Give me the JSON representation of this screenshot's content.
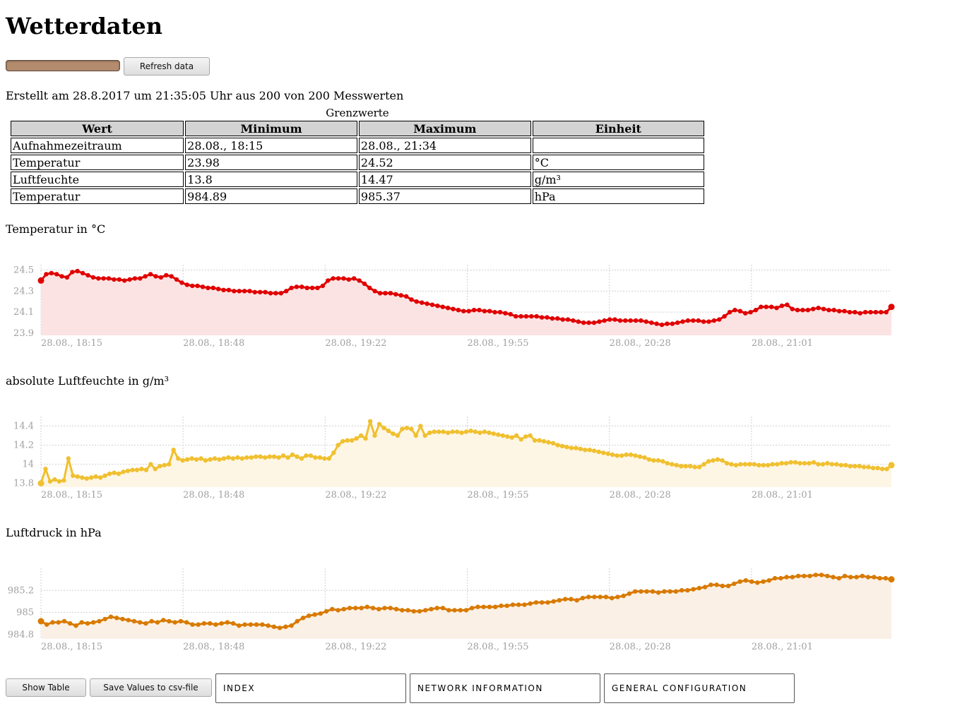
{
  "page": {
    "title": "Wetterdaten"
  },
  "toolbar": {
    "refresh_label": "Refresh data"
  },
  "loader": {
    "progress": 1.0
  },
  "info": "Erstellt am 28.8.2017 um 21:35:05 Uhr aus 200 von 200 Messwerten",
  "limits": {
    "caption": "Grenzwerte",
    "headers": [
      "Wert",
      "Minimum",
      "Maximum",
      "Einheit"
    ],
    "rows": [
      [
        "Aufnahmezeitraum",
        "28.08., 18:15",
        "28.08., 21:34",
        ""
      ],
      [
        "Temperatur",
        "23.98",
        "24.52",
        "°C"
      ],
      [
        "Luftfeuchte",
        "13.8",
        "14.47",
        "g/m³"
      ],
      [
        "Temperatur",
        "984.89",
        "985.37",
        "hPa"
      ]
    ]
  },
  "bottom": {
    "show_table": "Show Table",
    "save_csv": "Save Values to csv-file",
    "nav": [
      "INDEX",
      "NETWORK INFORMATION",
      "GENERAL CONFIGURATION"
    ]
  },
  "chart_data": [
    {
      "type": "area",
      "title": "Temperatur in °C",
      "x_ticks": [
        "28.08., 18:15",
        "28.08., 18:48",
        "28.08., 19:22",
        "28.08., 19:55",
        "28.08., 20:28",
        "28.08., 21:01"
      ],
      "x_range": [
        "28.08., 18:15",
        "28.08., 21:34"
      ],
      "y_ticks": [
        "23.9",
        "24.1",
        "24.3",
        "24.5"
      ],
      "ylim": [
        23.88,
        24.55
      ],
      "color": "#e00000",
      "fill": "#fbe3e3",
      "grid": true,
      "series": [
        {
          "values": [
            24.4,
            24.46,
            24.47,
            24.46,
            24.44,
            24.43,
            24.48,
            24.49,
            24.47,
            24.45,
            24.43,
            24.42,
            24.42,
            24.42,
            24.41,
            24.41,
            24.4,
            24.41,
            24.42,
            24.42,
            24.44,
            24.46,
            24.44,
            24.43,
            24.45,
            24.44,
            24.41,
            24.38,
            24.36,
            24.35,
            24.35,
            24.34,
            24.33,
            24.33,
            24.32,
            24.31,
            24.31,
            24.3,
            24.3,
            24.3,
            24.3,
            24.29,
            24.29,
            24.29,
            24.28,
            24.28,
            24.28,
            24.3,
            24.33,
            24.34,
            24.34,
            24.33,
            24.33,
            24.33,
            24.35,
            24.4,
            24.42,
            24.42,
            24.42,
            24.41,
            24.42,
            24.4,
            24.37,
            24.33,
            24.3,
            24.28,
            24.28,
            24.28,
            24.27,
            24.26,
            24.25,
            24.22,
            24.2,
            24.19,
            24.18,
            24.17,
            24.16,
            24.15,
            24.14,
            24.13,
            24.12,
            24.11,
            24.11,
            24.12,
            24.12,
            24.11,
            24.11,
            24.1,
            24.1,
            24.09,
            24.08,
            24.06,
            24.06,
            24.06,
            24.06,
            24.06,
            24.05,
            24.05,
            24.04,
            24.04,
            24.03,
            24.03,
            24.02,
            24.01,
            24.0,
            24.0,
            24.0,
            24.01,
            24.02,
            24.03,
            24.03,
            24.02,
            24.02,
            24.02,
            24.02,
            24.02,
            24.01,
            24.0,
            23.99,
            23.98,
            23.99,
            23.99,
            24.0,
            24.01,
            24.02,
            24.02,
            24.02,
            24.01,
            24.01,
            24.02,
            24.03,
            24.06,
            24.1,
            24.12,
            24.11,
            24.09,
            24.1,
            24.12,
            24.15,
            24.15,
            24.15,
            24.14,
            24.16,
            24.17,
            24.13,
            24.12,
            24.12,
            24.12,
            24.13,
            24.14,
            24.13,
            24.12,
            24.12,
            24.11,
            24.11,
            24.1,
            24.1,
            24.09,
            24.1,
            24.1,
            24.1,
            24.1,
            24.1,
            24.15
          ]
        }
      ]
    },
    {
      "type": "area",
      "title": "absolute Luftfeuchte in g/m³",
      "x_ticks": [
        "28.08., 18:15",
        "28.08., 18:48",
        "28.08., 19:22",
        "28.08., 19:55",
        "28.08., 20:28",
        "28.08., 21:01"
      ],
      "x_range": [
        "28.08., 18:15",
        "28.08., 21:34"
      ],
      "y_ticks": [
        "13.8",
        "14",
        "14.2",
        "14.4"
      ],
      "ylim": [
        13.76,
        14.5
      ],
      "color": "#f0c030",
      "fill": "#fdf6e5",
      "grid": true,
      "series": [
        {
          "values": [
            13.8,
            13.95,
            13.82,
            13.84,
            13.82,
            13.83,
            14.06,
            13.88,
            13.87,
            13.86,
            13.85,
            13.86,
            13.87,
            13.86,
            13.88,
            13.9,
            13.91,
            13.9,
            13.92,
            13.93,
            13.94,
            13.94,
            13.95,
            13.94,
            14.0,
            13.95,
            13.98,
            13.99,
            14.0,
            14.15,
            14.06,
            14.04,
            14.05,
            14.06,
            14.05,
            14.06,
            14.04,
            14.05,
            14.06,
            14.05,
            14.06,
            14.07,
            14.06,
            14.07,
            14.06,
            14.07,
            14.07,
            14.08,
            14.08,
            14.07,
            14.08,
            14.08,
            14.07,
            14.09,
            14.07,
            14.1,
            14.08,
            14.06,
            14.09,
            14.09,
            14.07,
            14.07,
            14.06,
            14.06,
            14.12,
            14.2,
            14.24,
            14.25,
            14.25,
            14.27,
            14.3,
            14.27,
            14.45,
            14.3,
            14.42,
            14.38,
            14.35,
            14.32,
            14.3,
            14.37,
            14.38,
            14.37,
            14.3,
            14.4,
            14.3,
            14.33,
            14.34,
            14.34,
            14.34,
            14.33,
            14.34,
            14.34,
            14.33,
            14.34,
            14.35,
            14.34,
            14.33,
            14.34,
            14.33,
            14.32,
            14.31,
            14.3,
            14.29,
            14.28,
            14.3,
            14.26,
            14.29,
            14.3,
            14.25,
            14.25,
            14.24,
            14.23,
            14.22,
            14.2,
            14.19,
            14.18,
            14.17,
            14.17,
            14.16,
            14.15,
            14.15,
            14.14,
            14.13,
            14.12,
            14.11,
            14.1,
            14.09,
            14.09,
            14.1,
            14.1,
            14.09,
            14.08,
            14.07,
            14.05,
            14.04,
            14.04,
            14.03,
            14.01,
            14.0,
            13.99,
            13.98,
            13.98,
            13.98,
            13.97,
            13.97,
            14.0,
            14.03,
            14.04,
            14.05,
            14.04,
            14.01,
            14.0,
            13.99,
            14.0,
            14.0,
            14.0,
            14.0,
            13.99,
            13.99,
            13.99,
            14.0,
            14.0,
            14.01,
            14.01,
            14.02,
            14.02,
            14.01,
            14.01,
            14.01,
            14.02,
            14.0,
            14.0,
            14.01,
            14.0,
            14.0,
            13.99,
            13.99,
            13.98,
            13.98,
            13.98,
            13.97,
            13.97,
            13.96,
            13.96,
            13.95,
            13.95,
            13.99
          ]
        }
      ]
    },
    {
      "type": "area",
      "title": "Luftdruck in hPa",
      "x_ticks": [
        "28.08., 18:15",
        "28.08., 18:48",
        "28.08., 19:22",
        "28.08., 19:55",
        "28.08., 20:28",
        "28.08., 21:01"
      ],
      "x_range": [
        "28.08., 18:15",
        "28.08., 21:34"
      ],
      "y_ticks": [
        "984.8",
        "985",
        "985.2"
      ],
      "ylim": [
        984.76,
        985.4
      ],
      "color": "#d87a00",
      "fill": "#fbf0e5",
      "grid": true,
      "series": [
        {
          "values": [
            984.92,
            984.89,
            984.91,
            984.91,
            984.92,
            984.9,
            984.88,
            984.91,
            984.9,
            984.91,
            984.92,
            984.94,
            984.96,
            984.95,
            984.94,
            984.93,
            984.92,
            984.91,
            984.9,
            984.92,
            984.91,
            984.93,
            984.92,
            984.91,
            984.92,
            984.91,
            984.89,
            984.89,
            984.9,
            984.9,
            984.89,
            984.9,
            984.91,
            984.9,
            984.88,
            984.89,
            984.89,
            984.89,
            984.89,
            984.88,
            984.87,
            984.86,
            984.87,
            984.88,
            984.92,
            984.95,
            984.97,
            984.98,
            984.99,
            985.01,
            985.03,
            985.02,
            985.03,
            985.04,
            985.04,
            985.04,
            985.05,
            985.04,
            985.03,
            985.04,
            985.04,
            985.03,
            985.02,
            985.02,
            985.01,
            985.01,
            985.02,
            985.03,
            985.04,
            985.04,
            985.02,
            985.02,
            985.02,
            985.02,
            985.04,
            985.05,
            985.05,
            985.05,
            985.05,
            985.06,
            985.06,
            985.07,
            985.07,
            985.07,
            985.08,
            985.09,
            985.09,
            985.09,
            985.1,
            985.11,
            985.12,
            985.12,
            985.11,
            985.13,
            985.14,
            985.14,
            985.14,
            985.14,
            985.13,
            985.14,
            985.15,
            985.17,
            985.19,
            985.19,
            985.19,
            985.19,
            985.18,
            985.19,
            985.19,
            985.19,
            985.2,
            985.2,
            985.21,
            985.22,
            985.23,
            985.25,
            985.25,
            985.24,
            985.24,
            985.26,
            985.28,
            985.29,
            985.28,
            985.27,
            985.28,
            985.29,
            985.31,
            985.31,
            985.32,
            985.32,
            985.33,
            985.33,
            985.33,
            985.34,
            985.34,
            985.33,
            985.32,
            985.31,
            985.33,
            985.32,
            985.32,
            985.33,
            985.32,
            985.32,
            985.31,
            985.31,
            985.3
          ]
        }
      ]
    }
  ]
}
